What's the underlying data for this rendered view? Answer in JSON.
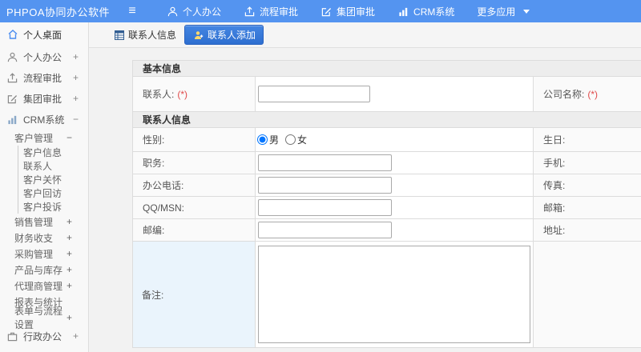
{
  "header": {
    "logo": "PHPOA协同办公软件",
    "nav": [
      {
        "label": "个人办公"
      },
      {
        "label": "流程审批"
      },
      {
        "label": "集团审批"
      },
      {
        "label": "CRM系统"
      },
      {
        "label": "更多应用"
      }
    ]
  },
  "sidebar": {
    "desktop_label": "个人桌面",
    "top": [
      {
        "label": "个人办公",
        "sign": "+"
      },
      {
        "label": "流程审批",
        "sign": "+"
      },
      {
        "label": "集团审批",
        "sign": "+"
      },
      {
        "label": "CRM系统",
        "sign": "−"
      }
    ],
    "crm": {
      "customer_group": {
        "label": "客户管理",
        "sign": "−"
      },
      "customer_children": [
        "客户信息",
        "联系人",
        "客户关怀",
        "客户回访",
        "客户投诉"
      ],
      "others": [
        {
          "label": "销售管理",
          "sign": "+"
        },
        {
          "label": "财务收支",
          "sign": "+"
        },
        {
          "label": "采购管理",
          "sign": "+"
        },
        {
          "label": "产品与库存",
          "sign": "+"
        },
        {
          "label": "代理商管理",
          "sign": "+"
        },
        {
          "label": "报表与统计",
          "sign": ""
        },
        {
          "label": "表单与流程设置",
          "sign": "+"
        }
      ]
    },
    "admin": {
      "label": "行政办公",
      "sign": "+"
    }
  },
  "tabs": {
    "list_tab": "联系人信息",
    "add_tab": "联系人添加"
  },
  "form": {
    "required_marker": "(*)",
    "section_basic": "基本信息",
    "section_contact": "联系人信息",
    "contact_label": "联系人:",
    "company_label": "公司名称:",
    "gender_label": "性别:",
    "gender_male": "男",
    "gender_female": "女",
    "birthday_label": "生日:",
    "job_label": "职务:",
    "mobile_label": "手机:",
    "office_phone_label": "办公电话:",
    "fax_label": "传真:",
    "qq_label": "QQ/MSN:",
    "email_label": "邮箱:",
    "zip_label": "邮编:",
    "address_label": "地址:",
    "note_label": "备注:",
    "inputs": {
      "contact_value": "",
      "job_value": "",
      "office_phone_value": "",
      "qq_value": "",
      "zip_value": "",
      "note_value": ""
    }
  }
}
